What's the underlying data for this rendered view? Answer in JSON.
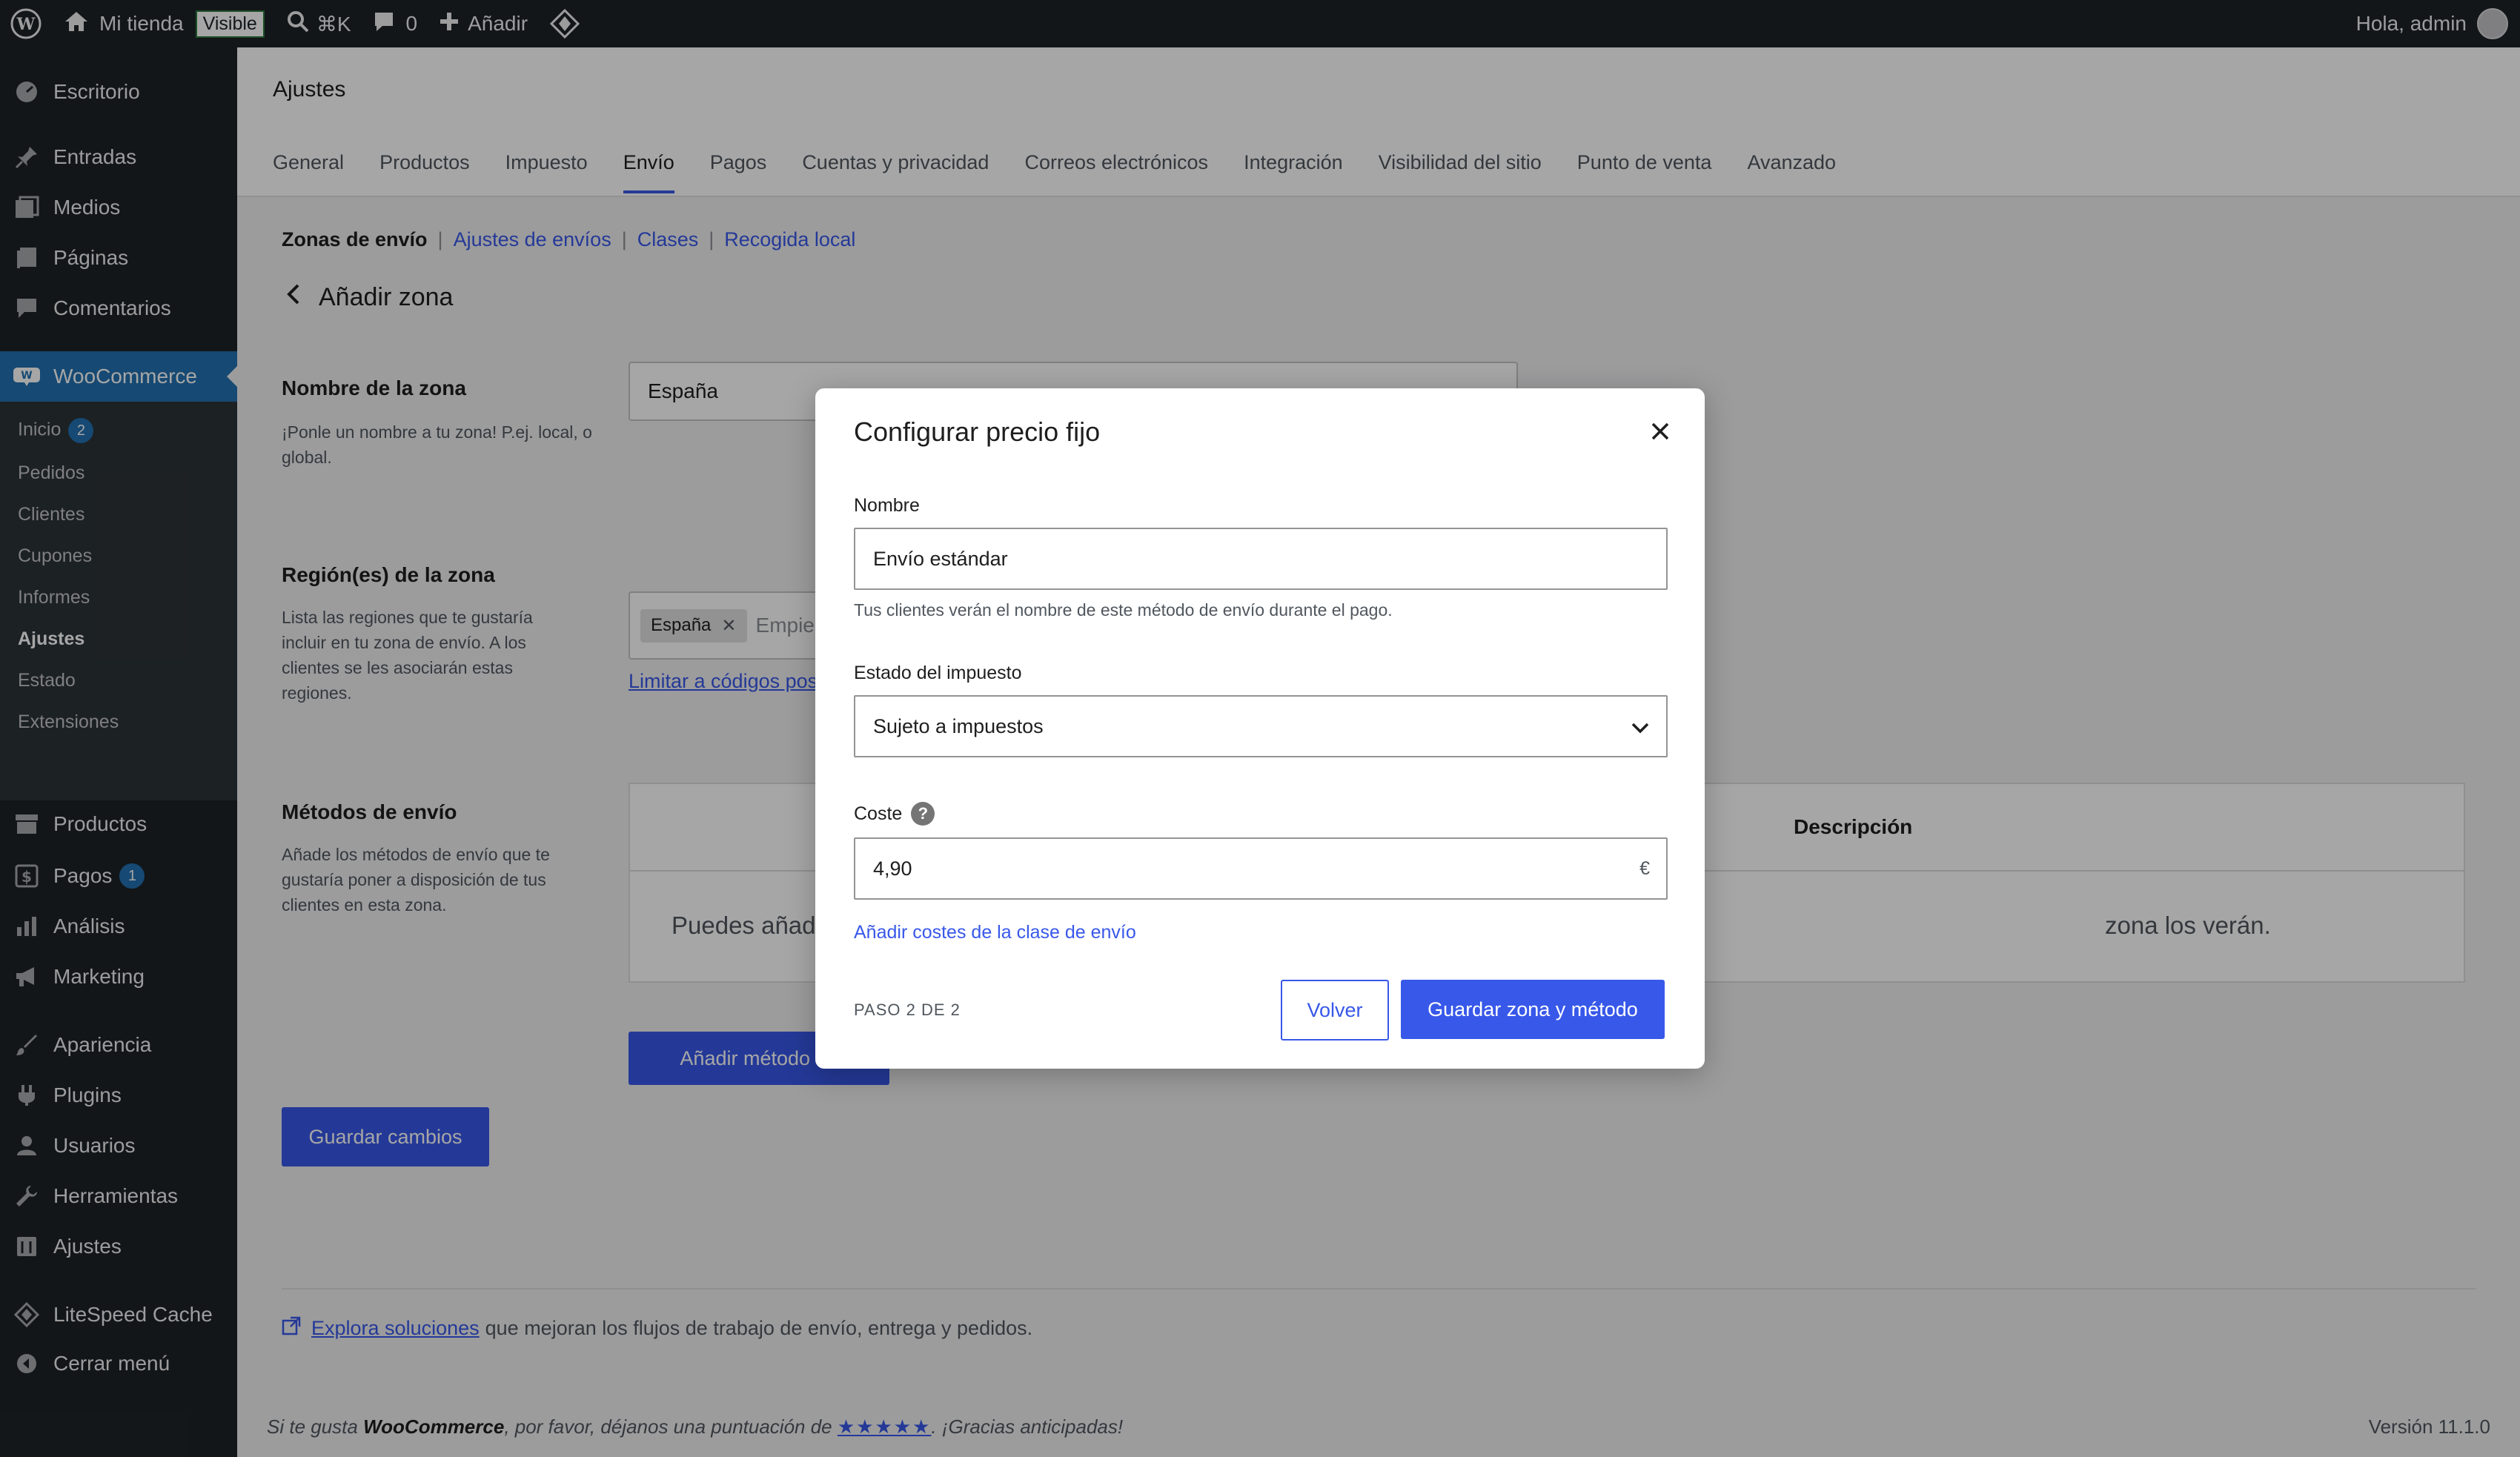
{
  "adminbar": {
    "site_name": "Mi tienda",
    "visible_label": "Visible",
    "search_shortcut": "⌘K",
    "comments_count": "0",
    "add_label": "Añadir",
    "greeting": "Hola, admin"
  },
  "sidebar": {
    "items": [
      {
        "label": "Escritorio"
      },
      {
        "label": "Entradas"
      },
      {
        "label": "Medios"
      },
      {
        "label": "Páginas"
      },
      {
        "label": "Comentarios"
      },
      {
        "label": "WooCommerce"
      },
      {
        "label": "Productos"
      },
      {
        "label": "Pagos",
        "badge": "1"
      },
      {
        "label": "Análisis"
      },
      {
        "label": "Marketing"
      },
      {
        "label": "Apariencia"
      },
      {
        "label": "Plugins"
      },
      {
        "label": "Usuarios"
      },
      {
        "label": "Herramientas"
      },
      {
        "label": "Ajustes"
      },
      {
        "label": "LiteSpeed Cache"
      },
      {
        "label": "Cerrar menú"
      }
    ],
    "woo_submenu": [
      {
        "label": "Inicio",
        "badge": "2"
      },
      {
        "label": "Pedidos"
      },
      {
        "label": "Clientes"
      },
      {
        "label": "Cupones"
      },
      {
        "label": "Informes"
      },
      {
        "label": "Ajustes"
      },
      {
        "label": "Estado"
      },
      {
        "label": "Extensiones"
      }
    ]
  },
  "header": {
    "title": "Ajustes",
    "tabs": [
      "General",
      "Productos",
      "Impuesto",
      "Envío",
      "Pagos",
      "Cuentas y privacidad",
      "Correos electrónicos",
      "Integración",
      "Visibilidad del sitio",
      "Punto de venta",
      "Avanzado"
    ],
    "active_tab": "Envío"
  },
  "subnav": {
    "current": "Zonas de envío",
    "links": [
      "Ajustes de envíos",
      "Clases",
      "Recogida local"
    ]
  },
  "page": {
    "back_title": "Añadir zona",
    "zone_name": {
      "title": "Nombre de la zona",
      "desc": "¡Ponle un nombre a tu zona! P.ej. local, o global.",
      "value": "España"
    },
    "zone_regions": {
      "title": "Región(es) de la zona",
      "desc": "Lista las regiones que te gustaría incluir en tu zona de envío. A los clientes se les asociarán estas regiones.",
      "chip": "España",
      "placeholder_partial": "Empie",
      "limit_link": "Limitar a códigos pos"
    },
    "methods": {
      "title": "Métodos de envío",
      "desc": "Añade los métodos de envío que te gustaría poner a disposición de tus clientes en esta zona.",
      "col_description": "Descripción",
      "empty_left": "Puedes añad",
      "empty_right": "zona los verán.",
      "add_button": "Añadir método de"
    },
    "save_button": "Guardar cambios",
    "explore_link": "Explora soluciones",
    "explore_rest": "que mejoran los flujos de trabajo de envío, entrega y pedidos.",
    "footer_pre": "Si te gusta ",
    "footer_brand": "WooCommerce",
    "footer_mid": ", por favor, déjanos una puntuación de ",
    "footer_stars": "★★★★★",
    "footer_post": ". ¡Gracias anticipadas!",
    "version": "Versión 11.1.0"
  },
  "modal": {
    "title": "Configurar precio fijo",
    "name_label": "Nombre",
    "name_value": "Envío estándar",
    "name_help": "Tus clientes verán el nombre de este método de envío durante el pago.",
    "tax_label": "Estado del impuesto",
    "tax_value": "Sujeto a impuestos",
    "cost_label": "Coste",
    "cost_value": "4,90",
    "currency": "€",
    "add_class_costs": "Añadir costes de la clase de envío",
    "step": "PASO 2 DE 2",
    "back_button": "Volver",
    "save_button": "Guardar zona y método"
  },
  "colors": {
    "accent": "#3858e9",
    "adminbar": "#1d2327",
    "sidebar_active": "#2271b1"
  }
}
